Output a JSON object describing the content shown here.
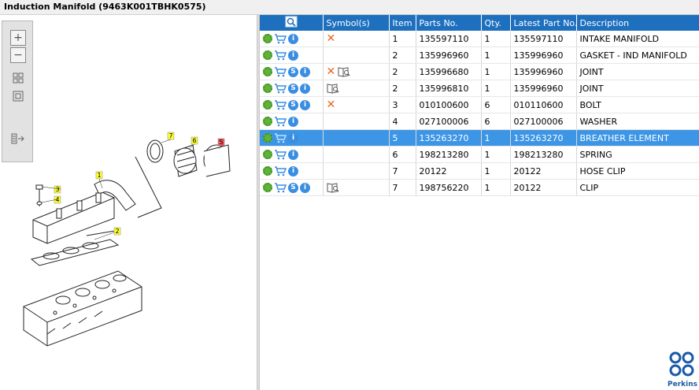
{
  "window": {
    "title": "Induction Manifold (9463K001TBHK0575)"
  },
  "toolbar": {
    "zoom_in": "zoom-in",
    "zoom_out": "zoom-out",
    "fit": "fit",
    "actual": "actual-size",
    "export": "export"
  },
  "diagram": {
    "callouts": [
      "1",
      "2",
      "3",
      "4",
      "5",
      "6",
      "7"
    ]
  },
  "table": {
    "headers": [
      "",
      "Symbol(s)",
      "Item",
      "Parts No.",
      "Qty.",
      "Latest Part No.",
      "Description"
    ],
    "rows": [
      {
        "item": "1",
        "part_no": "135597110",
        "qty": "1",
        "latest": "135597110",
        "desc": "INTAKE MANIFOLD"
      },
      {
        "item": "2",
        "part_no": "135996960",
        "qty": "1",
        "latest": "135996960",
        "desc": "GASKET - IND MANIFOLD"
      },
      {
        "item": "2",
        "part_no": "135996680",
        "qty": "1",
        "latest": "135996960",
        "desc": "JOINT"
      },
      {
        "item": "2",
        "part_no": "135996810",
        "qty": "1",
        "latest": "135996960",
        "desc": "JOINT"
      },
      {
        "item": "3",
        "part_no": "010100600",
        "qty": "6",
        "latest": "010110600",
        "desc": "BOLT"
      },
      {
        "item": "4",
        "part_no": "027100006",
        "qty": "6",
        "latest": "027100006",
        "desc": "WASHER"
      },
      {
        "item": "5",
        "part_no": "135263270",
        "qty": "1",
        "latest": "135263270",
        "desc": "BREATHER ELEMENT"
      },
      {
        "item": "6",
        "part_no": "198213280",
        "qty": "1",
        "latest": "198213280",
        "desc": "SPRING"
      },
      {
        "item": "7",
        "part_no": "20122",
        "qty": "1",
        "latest": "20122",
        "desc": "HOSE CLIP"
      },
      {
        "item": "7",
        "part_no": "198756220",
        "qty": "1",
        "latest": "20122",
        "desc": "CLIP"
      }
    ],
    "s_badge": "S",
    "i_badge": "i"
  },
  "brand": {
    "name": "Perkins",
    "color": "#1a5aa8"
  },
  "colors": {
    "header": "#1e70bf",
    "selected_row": "#3d95e5",
    "accent_x": "#e4661c",
    "gear": "#5fb33a"
  }
}
